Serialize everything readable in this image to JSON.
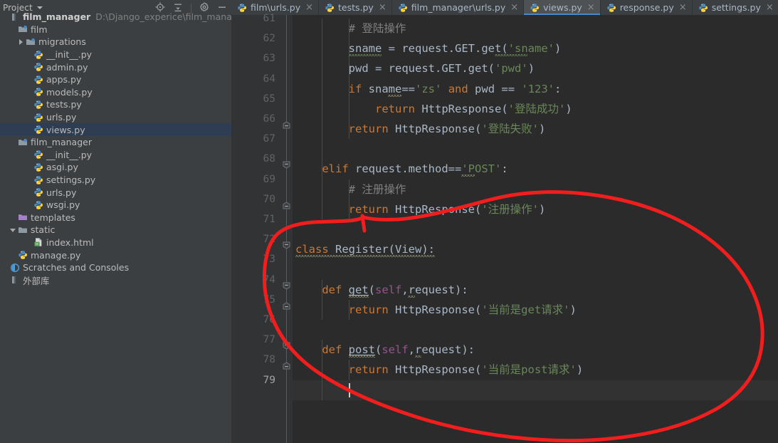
{
  "sidebar": {
    "title": "Project",
    "chevron_icon": "chevron-down-icon",
    "tools": [
      {
        "name": "locate-target-icon",
        "label": "Select Opened File"
      },
      {
        "name": "collapse-all-icon",
        "label": "Collapse All"
      },
      {
        "name": "gear-icon",
        "label": "Settings"
      },
      {
        "name": "minimize-icon",
        "label": "Hide"
      }
    ],
    "tree": [
      {
        "label": "film_manager",
        "sub": "D:\\Django_experice\\film_manager",
        "icon": "module-icon",
        "twisty": "none",
        "indent": 0,
        "bold": true,
        "selected": false
      },
      {
        "label": "film",
        "sub": "",
        "icon": "folder-source-icon",
        "twisty": "none",
        "indent": 1,
        "bold": false,
        "selected": false
      },
      {
        "label": "migrations",
        "sub": "",
        "icon": "folder-source-icon",
        "twisty": "right",
        "indent": 2,
        "bold": false,
        "selected": false
      },
      {
        "label": "__init__.py",
        "sub": "",
        "icon": "python-file-icon",
        "twisty": "none",
        "indent": 3,
        "bold": false,
        "selected": false
      },
      {
        "label": "admin.py",
        "sub": "",
        "icon": "python-file-icon",
        "twisty": "none",
        "indent": 3,
        "bold": false,
        "selected": false
      },
      {
        "label": "apps.py",
        "sub": "",
        "icon": "python-file-icon",
        "twisty": "none",
        "indent": 3,
        "bold": false,
        "selected": false
      },
      {
        "label": "models.py",
        "sub": "",
        "icon": "python-file-icon",
        "twisty": "none",
        "indent": 3,
        "bold": false,
        "selected": false
      },
      {
        "label": "tests.py",
        "sub": "",
        "icon": "python-file-icon",
        "twisty": "none",
        "indent": 3,
        "bold": false,
        "selected": false
      },
      {
        "label": "urls.py",
        "sub": "",
        "icon": "python-file-icon",
        "twisty": "none",
        "indent": 3,
        "bold": false,
        "selected": false
      },
      {
        "label": "views.py",
        "sub": "",
        "icon": "python-file-icon",
        "twisty": "none",
        "indent": 3,
        "bold": false,
        "selected": true
      },
      {
        "label": "film_manager",
        "sub": "",
        "icon": "folder-source-icon",
        "twisty": "none",
        "indent": 1,
        "bold": false,
        "selected": false
      },
      {
        "label": "__init__.py",
        "sub": "",
        "icon": "python-file-icon",
        "twisty": "none",
        "indent": 3,
        "bold": false,
        "selected": false
      },
      {
        "label": "asgi.py",
        "sub": "",
        "icon": "python-file-icon",
        "twisty": "none",
        "indent": 3,
        "bold": false,
        "selected": false
      },
      {
        "label": "settings.py",
        "sub": "",
        "icon": "python-file-icon",
        "twisty": "none",
        "indent": 3,
        "bold": false,
        "selected": false
      },
      {
        "label": "urls.py",
        "sub": "",
        "icon": "python-file-icon",
        "twisty": "none",
        "indent": 3,
        "bold": false,
        "selected": false
      },
      {
        "label": "wsgi.py",
        "sub": "",
        "icon": "python-file-icon",
        "twisty": "none",
        "indent": 3,
        "bold": false,
        "selected": false
      },
      {
        "label": "templates",
        "sub": "",
        "icon": "folder-template-icon",
        "twisty": "none",
        "indent": 1,
        "bold": false,
        "selected": false
      },
      {
        "label": "static",
        "sub": "",
        "icon": "folder-icon",
        "twisty": "down",
        "indent": 1,
        "bold": false,
        "selected": false
      },
      {
        "label": "index.html",
        "sub": "",
        "icon": "html-file-icon",
        "twisty": "none",
        "indent": 3,
        "bold": false,
        "selected": false
      },
      {
        "label": "manage.py",
        "sub": "",
        "icon": "python-file-icon",
        "twisty": "none",
        "indent": 1,
        "bold": false,
        "selected": false
      },
      {
        "label": "Scratches and Consoles",
        "sub": "",
        "icon": "scratches-icon",
        "twisty": "none",
        "indent": 0,
        "bold": false,
        "selected": false
      },
      {
        "label": "外部库",
        "sub": "",
        "icon": "module-icon",
        "twisty": "none",
        "indent": 0,
        "bold": false,
        "selected": false
      }
    ]
  },
  "tabs": [
    {
      "label": "film\\urls.py",
      "icon": "python-file-icon",
      "active": false,
      "close_icon": "close-icon"
    },
    {
      "label": "tests.py",
      "icon": "python-file-icon",
      "active": false,
      "close_icon": "close-icon"
    },
    {
      "label": "film_manager\\urls.py",
      "icon": "python-file-icon",
      "active": false,
      "close_icon": "close-icon"
    },
    {
      "label": "views.py",
      "icon": "python-file-icon",
      "active": true,
      "close_icon": "close-icon"
    },
    {
      "label": "response.py",
      "icon": "python-file-icon",
      "active": false,
      "close_icon": "close-icon"
    },
    {
      "label": "settings.py",
      "icon": "python-file-icon",
      "active": false,
      "close_icon": "close-icon"
    }
  ],
  "editor": {
    "first_line": 61,
    "last_line": 79,
    "current_line": 79,
    "line_numbers": [
      "61",
      "62",
      "63",
      "64",
      "65",
      "66",
      "67",
      "68",
      "69",
      "70",
      "71",
      "72",
      "73",
      "74",
      "75",
      "76",
      "77",
      "78",
      "79"
    ],
    "lines": [
      {
        "n": "61",
        "text": "        # 登陆操作"
      },
      {
        "n": "62",
        "text": "        sname = request.GET.get('sname')"
      },
      {
        "n": "63",
        "text": "        pwd = request.GET.get('pwd')"
      },
      {
        "n": "64",
        "text": "        if sname=='zs' and pwd == '123':"
      },
      {
        "n": "65",
        "text": "            return HttpResponse('登陆成功')"
      },
      {
        "n": "66",
        "text": "        return HttpResponse('登陆失败')"
      },
      {
        "n": "67",
        "text": ""
      },
      {
        "n": "68",
        "text": "    elif request.method=='POST':"
      },
      {
        "n": "69",
        "text": "        # 注册操作"
      },
      {
        "n": "70",
        "text": "        return HttpResponse('注册操作')"
      },
      {
        "n": "71",
        "text": ""
      },
      {
        "n": "72",
        "text": "class Register(View):"
      },
      {
        "n": "73",
        "text": ""
      },
      {
        "n": "74",
        "text": "    def get(self,request):"
      },
      {
        "n": "75",
        "text": "        return HttpResponse('当前是get请求')"
      },
      {
        "n": "76",
        "text": ""
      },
      {
        "n": "77",
        "text": "    def post(self,request):"
      },
      {
        "n": "78",
        "text": "        return HttpResponse('当前是post请求')"
      },
      {
        "n": "79",
        "text": ""
      }
    ],
    "fold_markers": [
      {
        "line": "66",
        "type": "fold-end"
      },
      {
        "line": "68",
        "type": "fold-start"
      },
      {
        "line": "70",
        "type": "fold-end"
      },
      {
        "line": "72",
        "type": "fold-start"
      },
      {
        "line": "74",
        "type": "fold-start"
      },
      {
        "line": "75",
        "type": "fold-end"
      },
      {
        "line": "77",
        "type": "fold-start"
      },
      {
        "line": "78",
        "type": "fold-end"
      }
    ]
  },
  "annotation": {
    "name": "red-ellipse-highlight",
    "color": "#f21e1e",
    "stroke_width": 5,
    "encircles_lines": [
      "72",
      "73",
      "74",
      "75",
      "76",
      "77",
      "78",
      "79"
    ]
  },
  "colors": {
    "sidebar_bg": "#3c3f41",
    "editor_bg": "#2b2b2b",
    "gutter_bg": "#313335",
    "tab_active_bg": "#4e5254",
    "tab_active_underline": "#4a88c7",
    "tree_selected_bg": "#2f3d52",
    "keyword": "#cc7832",
    "string": "#6a8759",
    "comment": "#808080",
    "text": "#a9b7c6",
    "self_param": "#94558d",
    "function": "#ffc66d",
    "number": "#6897bb",
    "annotation_red": "#f21e1e"
  }
}
